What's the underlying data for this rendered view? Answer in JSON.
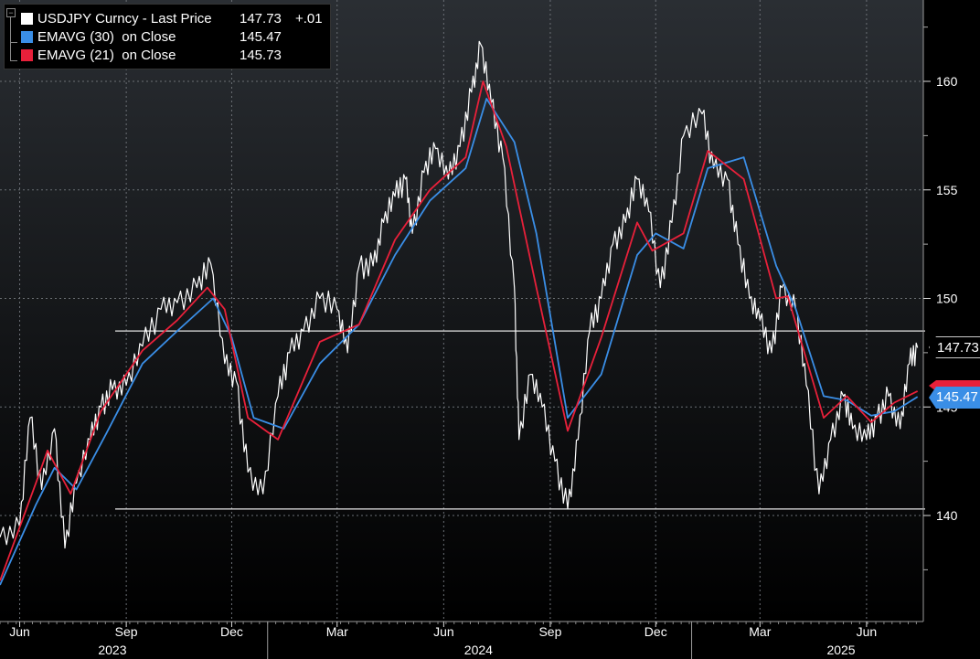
{
  "legend": {
    "main": {
      "label": "USDJPY Curncy - Last Price",
      "value": "147.73",
      "change": "+.01",
      "color": "#ffffff"
    },
    "ema30": {
      "label": "EMAVG (30)  on Close",
      "value": "145.47",
      "color": "#3a8ee6"
    },
    "ema21": {
      "label": "EMAVG (21)  on Close",
      "value": "145.73",
      "color": "#e8203a"
    }
  },
  "tags": {
    "last_price": "147.73",
    "ema30": "145.47"
  },
  "chart_data": {
    "type": "line",
    "ylim": [
      135,
      163
    ],
    "y_ticks": [
      140,
      145,
      150,
      155,
      160
    ],
    "y_tick_labels": [
      "140",
      "145",
      "150",
      "155",
      "160"
    ],
    "x_range": [
      "2023-05-15",
      "2025-07-20"
    ],
    "x_month_ticks": [
      {
        "date": "2023-06-01",
        "label": "Jun"
      },
      {
        "date": "2023-09-01",
        "label": "Sep"
      },
      {
        "date": "2023-12-01",
        "label": "Dec"
      },
      {
        "date": "2024-03-01",
        "label": "Mar"
      },
      {
        "date": "2024-06-01",
        "label": "Jun"
      },
      {
        "date": "2024-09-01",
        "label": "Sep"
      },
      {
        "date": "2024-12-01",
        "label": "Dec"
      },
      {
        "date": "2025-03-01",
        "label": "Mar"
      },
      {
        "date": "2025-06-01",
        "label": "Jun"
      }
    ],
    "x_year_labels": [
      {
        "date": "2023-08-20",
        "label": "2023"
      },
      {
        "date": "2024-07-01",
        "label": "2024"
      },
      {
        "date": "2025-05-10",
        "label": "2025"
      }
    ],
    "year_dividers": [
      "2024-01-01",
      "2025-01-01"
    ],
    "horizontal_lines": [
      148.5,
      140.3
    ],
    "grid": true,
    "series": [
      {
        "name": "USDJPY Curncy - Last Price",
        "color": "#ffffff",
        "x": [
          "2023-05-15",
          "2023-06-01",
          "2023-06-10",
          "2023-06-20",
          "2023-07-01",
          "2023-07-10",
          "2023-07-20",
          "2023-08-01",
          "2023-08-10",
          "2023-08-20",
          "2023-09-01",
          "2023-09-15",
          "2023-10-01",
          "2023-10-15",
          "2023-11-01",
          "2023-11-13",
          "2023-11-25",
          "2023-12-05",
          "2023-12-15",
          "2023-12-28",
          "2024-01-10",
          "2024-01-20",
          "2024-02-01",
          "2024-02-15",
          "2024-03-01",
          "2024-03-10",
          "2024-03-20",
          "2024-04-01",
          "2024-04-10",
          "2024-04-20",
          "2024-04-29",
          "2024-05-05",
          "2024-05-15",
          "2024-05-25",
          "2024-06-05",
          "2024-06-15",
          "2024-06-25",
          "2024-07-03",
          "2024-07-12",
          "2024-07-22",
          "2024-08-01",
          "2024-08-05",
          "2024-08-15",
          "2024-08-25",
          "2024-09-05",
          "2024-09-16",
          "2024-09-25",
          "2024-10-05",
          "2024-10-15",
          "2024-10-25",
          "2024-11-05",
          "2024-11-15",
          "2024-11-25",
          "2024-12-05",
          "2024-12-15",
          "2024-12-25",
          "2025-01-10",
          "2025-01-20",
          "2025-02-01",
          "2025-02-10",
          "2025-02-20",
          "2025-03-01",
          "2025-03-11",
          "2025-03-20",
          "2025-04-01",
          "2025-04-10",
          "2025-04-21",
          "2025-05-01",
          "2025-05-12",
          "2025-05-20",
          "2025-06-01",
          "2025-06-10",
          "2025-06-20",
          "2025-06-30",
          "2025-07-08",
          "2025-07-15"
        ],
        "values": [
          139.0,
          139.5,
          144.5,
          141.2,
          144.0,
          138.5,
          141.5,
          143.5,
          145.0,
          145.8,
          146.0,
          147.8,
          149.5,
          149.8,
          150.5,
          151.6,
          147.0,
          146.2,
          142.0,
          141.0,
          145.5,
          147.5,
          148.5,
          150.0,
          149.5,
          147.5,
          151.5,
          151.5,
          153.5,
          154.7,
          155.5,
          153.0,
          155.8,
          156.9,
          155.5,
          157.0,
          159.5,
          161.7,
          159.0,
          156.5,
          150.5,
          143.5,
          146.5,
          145.0,
          142.5,
          140.3,
          143.5,
          148.5,
          150.0,
          152.5,
          153.5,
          155.5,
          154.0,
          150.5,
          153.5,
          157.5,
          158.5,
          156.0,
          155.5,
          152.5,
          150.0,
          149.0,
          147.5,
          150.5,
          149.5,
          146.0,
          141.0,
          143.5,
          145.5,
          144.0,
          143.5,
          144.5,
          145.5,
          144.0,
          147.0,
          147.73
        ]
      },
      {
        "name": "EMAVG (30)  on Close",
        "color": "#3a8ee6",
        "x": [
          "2023-05-15",
          "2023-06-15",
          "2023-07-01",
          "2023-07-20",
          "2023-08-15",
          "2023-09-15",
          "2023-10-15",
          "2023-11-15",
          "2023-12-01",
          "2023-12-20",
          "2024-01-15",
          "2024-02-15",
          "2024-03-20",
          "2024-04-20",
          "2024-05-20",
          "2024-06-20",
          "2024-07-08",
          "2024-08-01",
          "2024-08-20",
          "2024-09-16",
          "2024-10-15",
          "2024-11-15",
          "2024-12-01",
          "2024-12-25",
          "2025-01-15",
          "2025-02-15",
          "2025-03-15",
          "2025-04-01",
          "2025-04-25",
          "2025-05-15",
          "2025-06-05",
          "2025-06-25",
          "2025-07-15"
        ],
        "values": [
          136.8,
          140.5,
          142.2,
          141.2,
          143.8,
          147.0,
          148.5,
          150.0,
          148.2,
          144.5,
          144.0,
          147.0,
          148.8,
          152.0,
          154.5,
          156.0,
          159.2,
          157.2,
          153.0,
          144.5,
          146.5,
          152.0,
          153.0,
          152.3,
          156.0,
          156.5,
          151.5,
          149.5,
          145.5,
          145.3,
          144.6,
          144.8,
          145.47
        ]
      },
      {
        "name": "EMAVG (21)  on Close",
        "color": "#e8203a",
        "x": [
          "2023-05-15",
          "2023-06-15",
          "2023-06-25",
          "2023-07-15",
          "2023-08-10",
          "2023-09-15",
          "2023-10-15",
          "2023-11-10",
          "2023-11-25",
          "2023-12-15",
          "2024-01-10",
          "2024-02-15",
          "2024-03-20",
          "2024-04-20",
          "2024-05-20",
          "2024-06-20",
          "2024-07-05",
          "2024-07-25",
          "2024-08-20",
          "2024-09-16",
          "2024-10-15",
          "2024-11-15",
          "2024-11-28",
          "2024-12-25",
          "2025-01-15",
          "2025-02-15",
          "2025-03-15",
          "2025-03-25",
          "2025-04-25",
          "2025-05-15",
          "2025-06-05",
          "2025-06-25",
          "2025-07-15"
        ],
        "values": [
          137.0,
          141.5,
          143.0,
          141.0,
          144.8,
          147.6,
          149.0,
          150.5,
          149.5,
          144.5,
          143.5,
          148.0,
          148.8,
          152.7,
          155.0,
          156.5,
          160.0,
          157.0,
          150.5,
          143.9,
          148.2,
          153.5,
          152.2,
          153.0,
          156.8,
          155.5,
          150.0,
          150.1,
          144.5,
          145.5,
          144.3,
          145.2,
          145.73
        ]
      }
    ]
  }
}
